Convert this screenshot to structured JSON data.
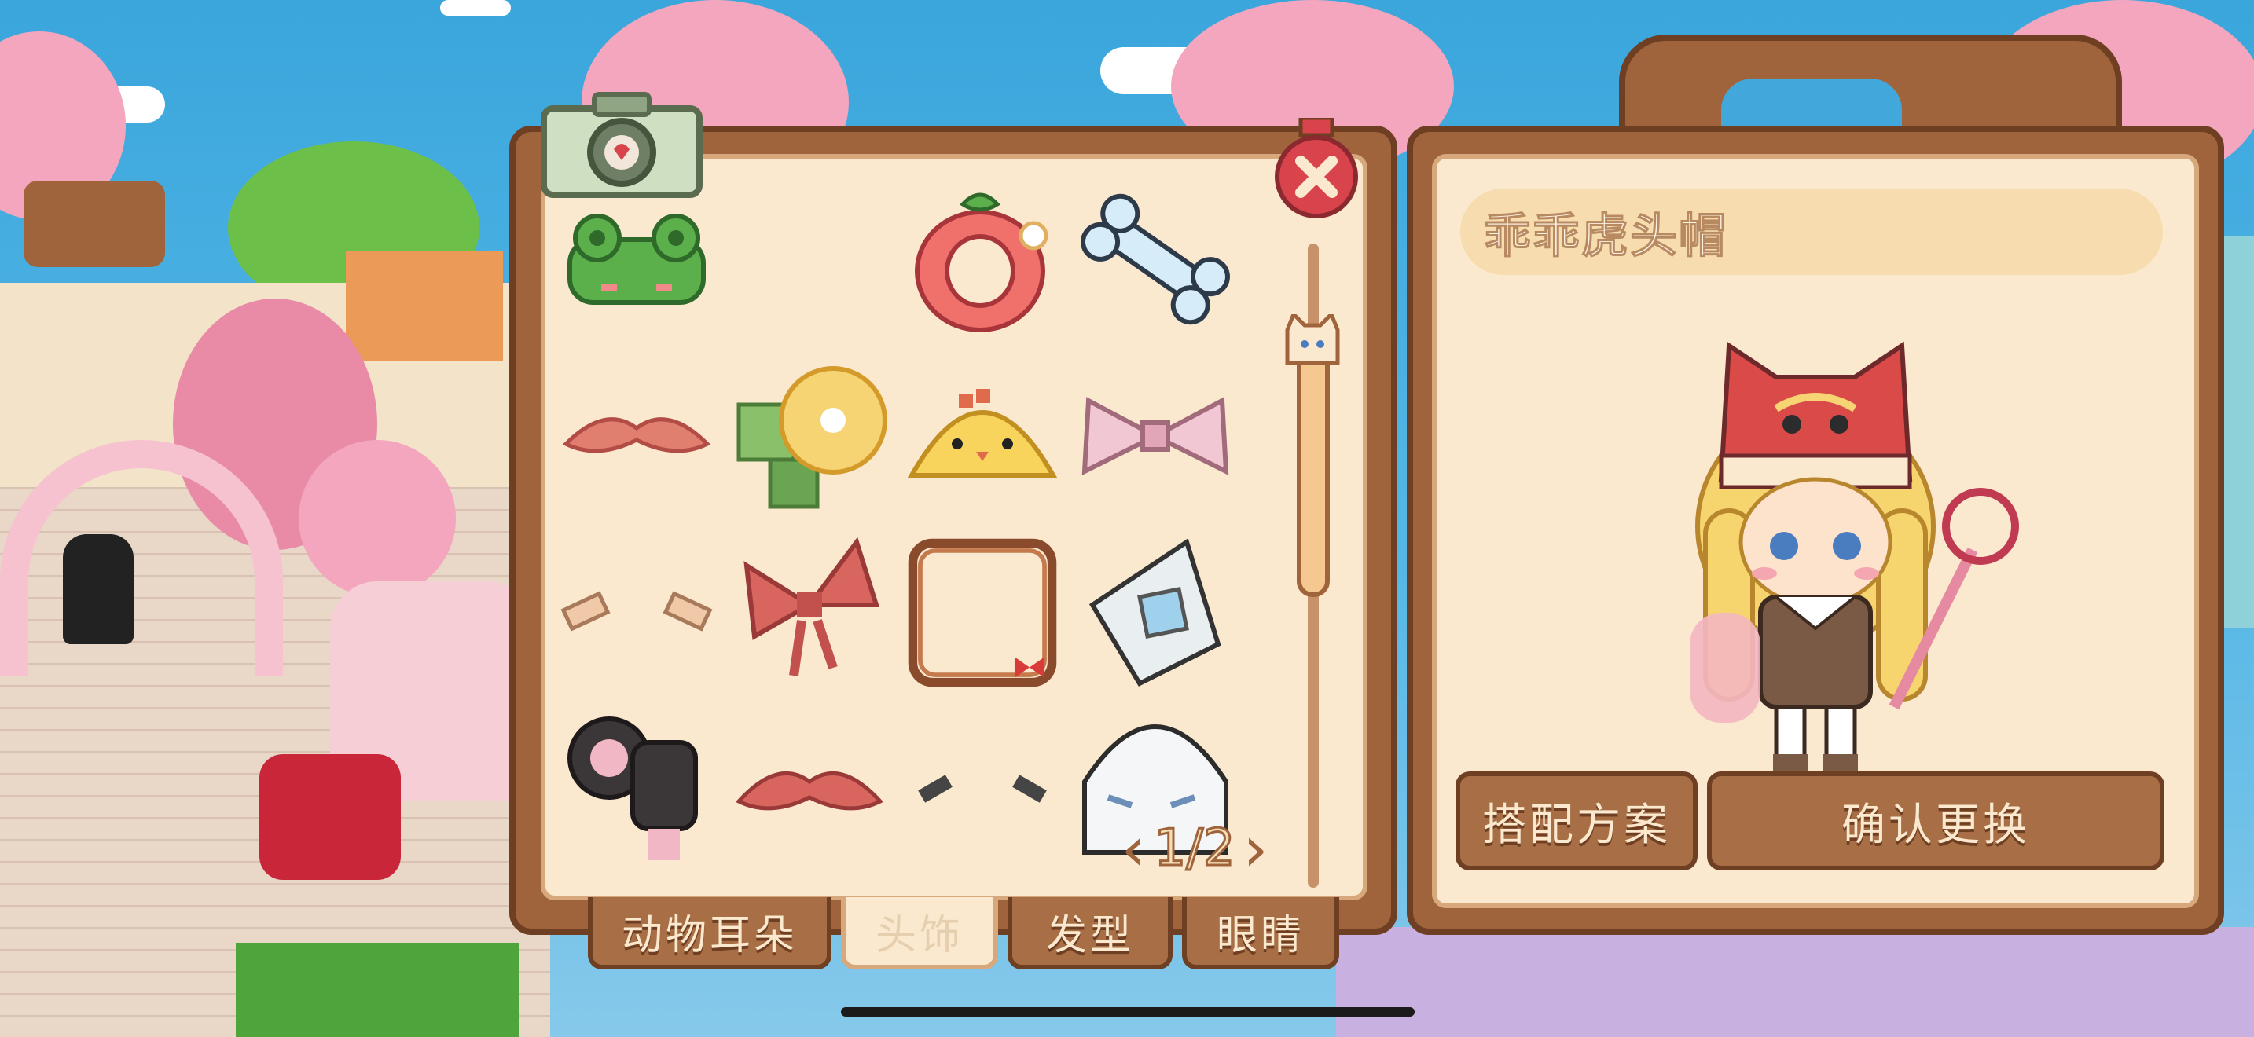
{
  "item_name": "乖乖虎头帽",
  "buttons": {
    "outfit_plan": "搭配方案",
    "confirm_change": "确认更换"
  },
  "pagination": {
    "current": "1/2",
    "prev": "‹",
    "next": "›"
  },
  "tabs": [
    {
      "label": "动物耳朵",
      "active": false
    },
    {
      "label": "头饰",
      "active": true
    },
    {
      "label": "发型",
      "active": false
    },
    {
      "label": "眼睛",
      "active": false
    }
  ],
  "items": [
    {
      "name": "frog-hat-icon"
    },
    {
      "name": "empty-slot"
    },
    {
      "name": "strawberry-ring-icon"
    },
    {
      "name": "bone-clip-icon"
    },
    {
      "name": "mustache-bow-icon"
    },
    {
      "name": "yellow-flower-icon"
    },
    {
      "name": "chick-band-icon"
    },
    {
      "name": "pink-bow-icon"
    },
    {
      "name": "bandage-clips-icon"
    },
    {
      "name": "red-bow-icon"
    },
    {
      "name": "frame-selected-icon"
    },
    {
      "name": "gem-clip-icon"
    },
    {
      "name": "mouse-ears-icon"
    },
    {
      "name": "red-mustache-icon"
    },
    {
      "name": "bone-pins-icon"
    },
    {
      "name": "ghost-hat-icon"
    }
  ],
  "colors": {
    "wood": "#a0643d",
    "wood_dark": "#6e3f22",
    "cream": "#fbe9cf",
    "close_red": "#d9434b"
  }
}
